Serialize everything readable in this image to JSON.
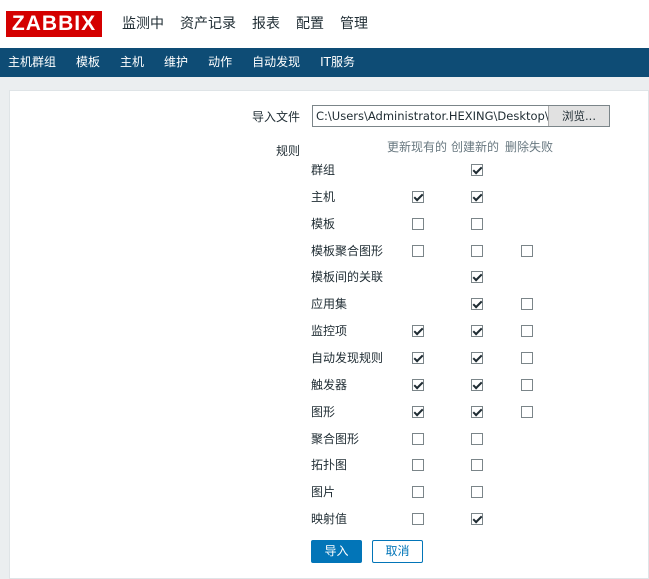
{
  "header": {
    "logo": "ZABBIX",
    "nav": [
      "监测中",
      "资产记录",
      "报表",
      "配置",
      "管理"
    ]
  },
  "subnav": [
    "主机群组",
    "模板",
    "主机",
    "维护",
    "动作",
    "自动发现",
    "IT服务"
  ],
  "form": {
    "import_file_label": "导入文件",
    "file_path": "C:\\Users\\Administrator.HEXING\\Desktop\\ng",
    "browse_label": "浏览...",
    "rules_label": "规则",
    "columns": [
      "更新现有的",
      "创建新的",
      "删除失败"
    ],
    "rules": [
      {
        "label": "群组",
        "update": null,
        "create": true,
        "delete": null
      },
      {
        "label": "主机",
        "update": true,
        "create": true,
        "delete": null
      },
      {
        "label": "模板",
        "update": false,
        "create": false,
        "delete": null
      },
      {
        "label": "模板聚合图形",
        "update": false,
        "create": false,
        "delete": false
      },
      {
        "label": "模板间的关联",
        "update": null,
        "create": true,
        "delete": null
      },
      {
        "label": "应用集",
        "update": null,
        "create": true,
        "delete": false
      },
      {
        "label": "监控项",
        "update": true,
        "create": true,
        "delete": false
      },
      {
        "label": "自动发现规则",
        "update": true,
        "create": true,
        "delete": false
      },
      {
        "label": "触发器",
        "update": true,
        "create": true,
        "delete": false
      },
      {
        "label": "图形",
        "update": true,
        "create": true,
        "delete": false
      },
      {
        "label": "聚合图形",
        "update": false,
        "create": false,
        "delete": null
      },
      {
        "label": "拓扑图",
        "update": false,
        "create": false,
        "delete": null
      },
      {
        "label": "图片",
        "update": false,
        "create": false,
        "delete": null
      },
      {
        "label": "映射值",
        "update": false,
        "create": true,
        "delete": null
      }
    ],
    "import_button": "导入",
    "cancel_button": "取消"
  }
}
